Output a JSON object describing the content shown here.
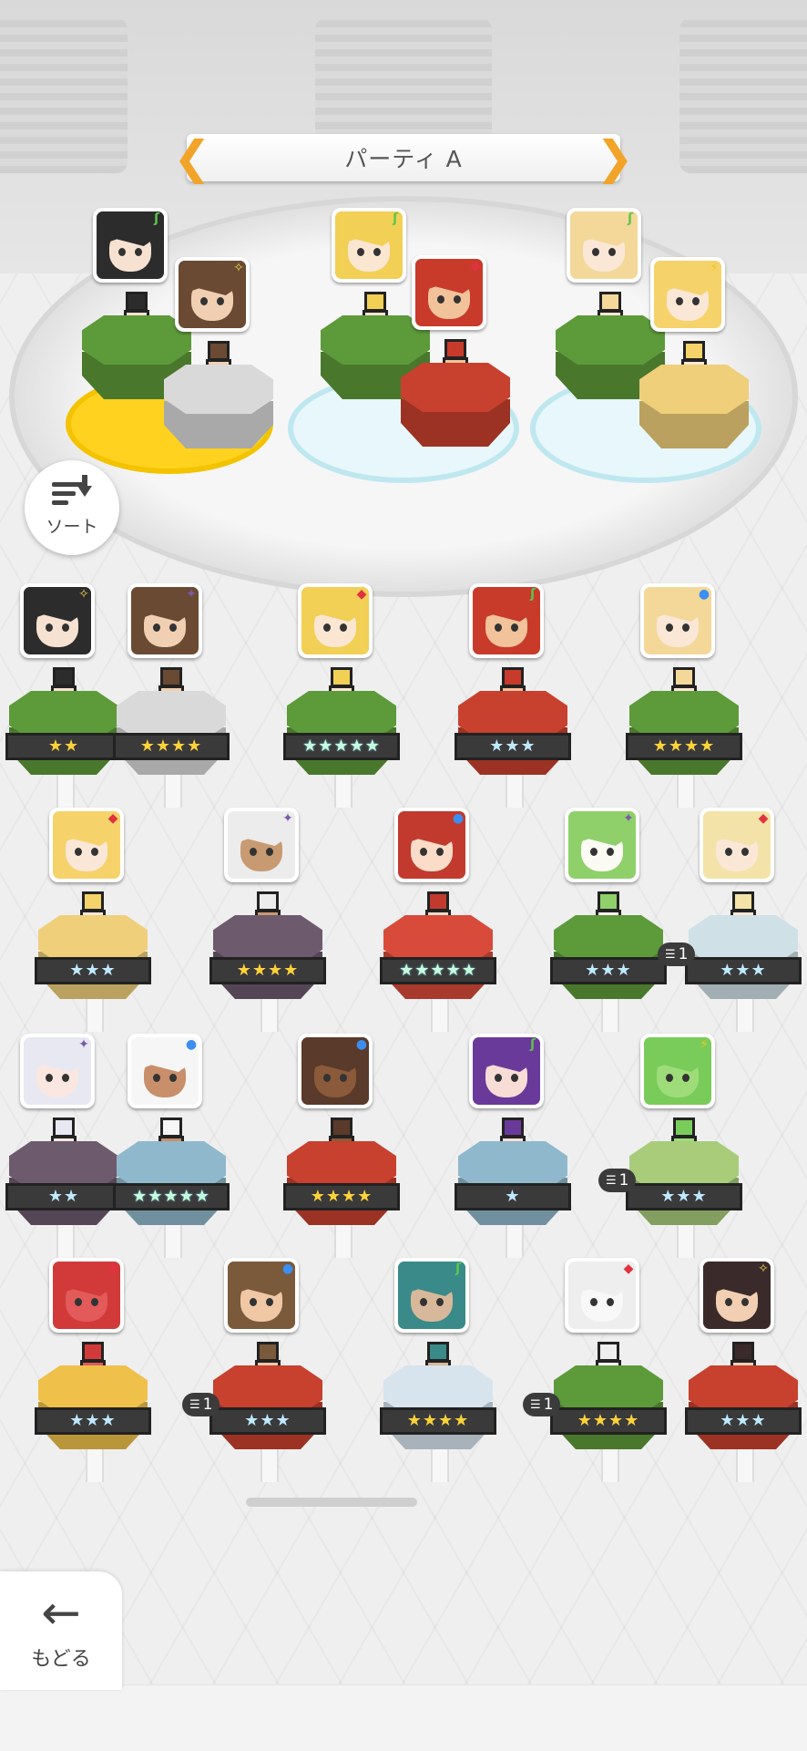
{
  "party": {
    "title": "パーティ A",
    "prev_arrow": "❮",
    "next_arrow": "❯"
  },
  "sort_button": {
    "label": "ソート",
    "icon": "sort-descending-icon"
  },
  "back_button": {
    "label": "もどる",
    "arrow": "←",
    "icon": "back-arrow-icon"
  },
  "element_icons": {
    "wind": "leaf-icon",
    "fire": "fire-diamond-icon",
    "dark": "dark-sparkle-icon",
    "light": "light-sparkle-icon",
    "water": "water-orb-icon",
    "thunder": "lightning-icon"
  },
  "element_glyphs": {
    "wind": "ʃ",
    "fire": "◆",
    "dark": "✦",
    "light": "✧",
    "water": "●",
    "thunder": "⚡"
  },
  "element_colors": {
    "wind": "#5ac84a",
    "fire": "#e0333f",
    "dark": "#7a5aa8",
    "light": "#e8d24a",
    "water": "#3c8ef0",
    "thunder": "#f2c52a"
  },
  "party_units": [
    {
      "element": "wind",
      "stars": ""
    },
    {
      "element": "light",
      "stars": ""
    },
    {
      "element": "wind",
      "stars": ""
    },
    {
      "element": "fire",
      "stars": ""
    },
    {
      "element": "wind",
      "stars": ""
    },
    {
      "element": "thunder",
      "stars": ""
    }
  ],
  "roster": [
    {
      "element": "light",
      "stars": "★★",
      "grade": "gold"
    },
    {
      "element": "dark",
      "stars": "★★★★",
      "grade": "gold"
    },
    {
      "element": "fire",
      "stars": "★★★★★",
      "grade": "rainbow"
    },
    {
      "element": "wind",
      "stars": "★★★",
      "grade": "silver"
    },
    {
      "element": "water",
      "stars": "★★★★",
      "grade": "gold"
    },
    {
      "element": "fire",
      "stars": "★★★",
      "grade": "silver"
    },
    {
      "element": "dark",
      "stars": "★★★★",
      "grade": "gold"
    },
    {
      "element": "water",
      "stars": "★★★★★",
      "grade": "rainbow"
    },
    {
      "element": "dark",
      "stars": "★★★",
      "grade": "silver"
    },
    {
      "element": "fire",
      "stars": "★★★",
      "grade": "silver",
      "badge": "1"
    },
    {
      "element": "dark",
      "stars": "★★",
      "grade": "silver"
    },
    {
      "element": "water",
      "stars": "★★★★★",
      "grade": "rainbow"
    },
    {
      "element": "water",
      "stars": "★★★★",
      "grade": "gold"
    },
    {
      "element": "wind",
      "stars": "★",
      "grade": "silver"
    },
    {
      "element": "thunder",
      "stars": "★★★",
      "grade": "silver",
      "badge": "1"
    },
    {
      "element": "fire",
      "stars": "★★★",
      "grade": "silver"
    },
    {
      "element": "water",
      "stars": "★★★",
      "grade": "silver",
      "badge": "1"
    },
    {
      "element": "wind",
      "stars": "★★★★",
      "grade": "gold"
    },
    {
      "element": "fire",
      "stars": "★★★★",
      "grade": "gold",
      "badge": "1"
    },
    {
      "element": "light",
      "stars": "★★★",
      "grade": "silver"
    }
  ]
}
